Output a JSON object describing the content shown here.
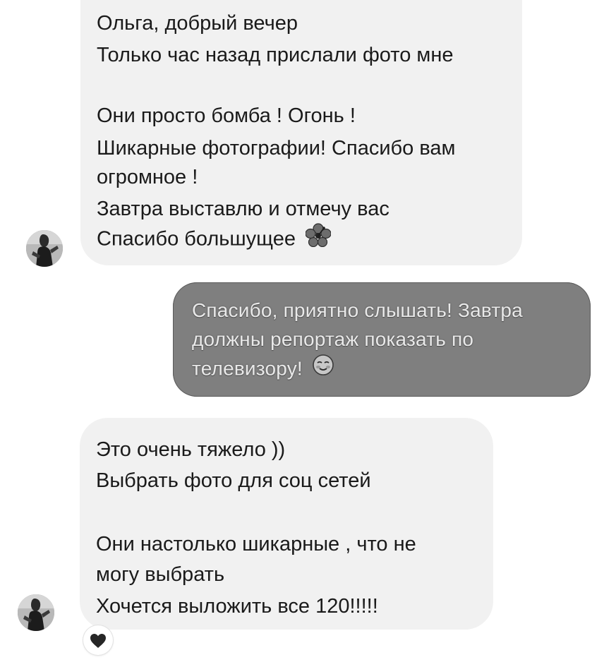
{
  "thread": {
    "messages": [
      {
        "direction": "incoming",
        "lines": [
          "Ольга, добрый вечер",
          "Только час назад прислали фото мне",
          "Они просто бомба ! Огонь !",
          "Шикарные фотографии! Спасибо вам",
          "огромное !",
          "Завтра выставлю и отмечу вас",
          "Спасибо большущее"
        ],
        "trailing_emoji": "hibiscus-flower-icon"
      },
      {
        "direction": "outgoing",
        "lines": [
          "Спасибо, приятно слышать! Завтра",
          "должны репортаж показать по",
          "телевизору!"
        ],
        "trailing_emoji": "smiling-face-icon"
      },
      {
        "direction": "incoming",
        "lines": [
          "Это очень тяжело ))",
          "Выбрать фото для соц сетей",
          "Они настолько шикарные , что не",
          "могу выбрать",
          "Хочется выложить все 120!!!!!"
        ],
        "reaction": "black-heart-icon"
      }
    ]
  },
  "colors": {
    "incoming_bubble": "#f1f1f1",
    "outgoing_bubble": "#7f7f7f",
    "incoming_text": "#1a1a1a",
    "outgoing_text": "#e9e9e9",
    "background": "#ffffff"
  }
}
